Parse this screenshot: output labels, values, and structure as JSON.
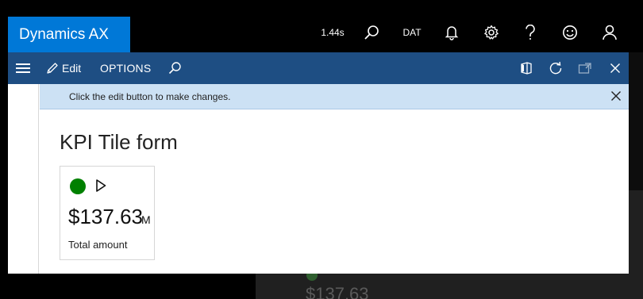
{
  "app": {
    "title": "Dynamics AX",
    "timer": "1.44s",
    "company": "DAT",
    "icons": [
      "search-icon",
      "bell-icon",
      "gear-icon",
      "help-icon",
      "smiley-icon",
      "user-icon"
    ]
  },
  "toolbar": {
    "edit_label": "Edit",
    "options_label": "OPTIONS",
    "icons": [
      "menu-icon",
      "pencil-icon",
      "search-icon",
      "office-icon",
      "refresh-icon",
      "popout-icon",
      "close-icon"
    ]
  },
  "infobar": {
    "message": "Click the edit button to make changes."
  },
  "form": {
    "title": "KPI Tile form"
  },
  "kpi_tile": {
    "value": "$137.63",
    "unit": "M",
    "label": "Total amount",
    "status_color": "#008000"
  },
  "background": {
    "ghost_value": "$137.63"
  },
  "colors": {
    "brand": "#0078d7",
    "dialog_bar": "#1e4e83",
    "infobar": "#cce1f4",
    "status_green": "#008000"
  }
}
